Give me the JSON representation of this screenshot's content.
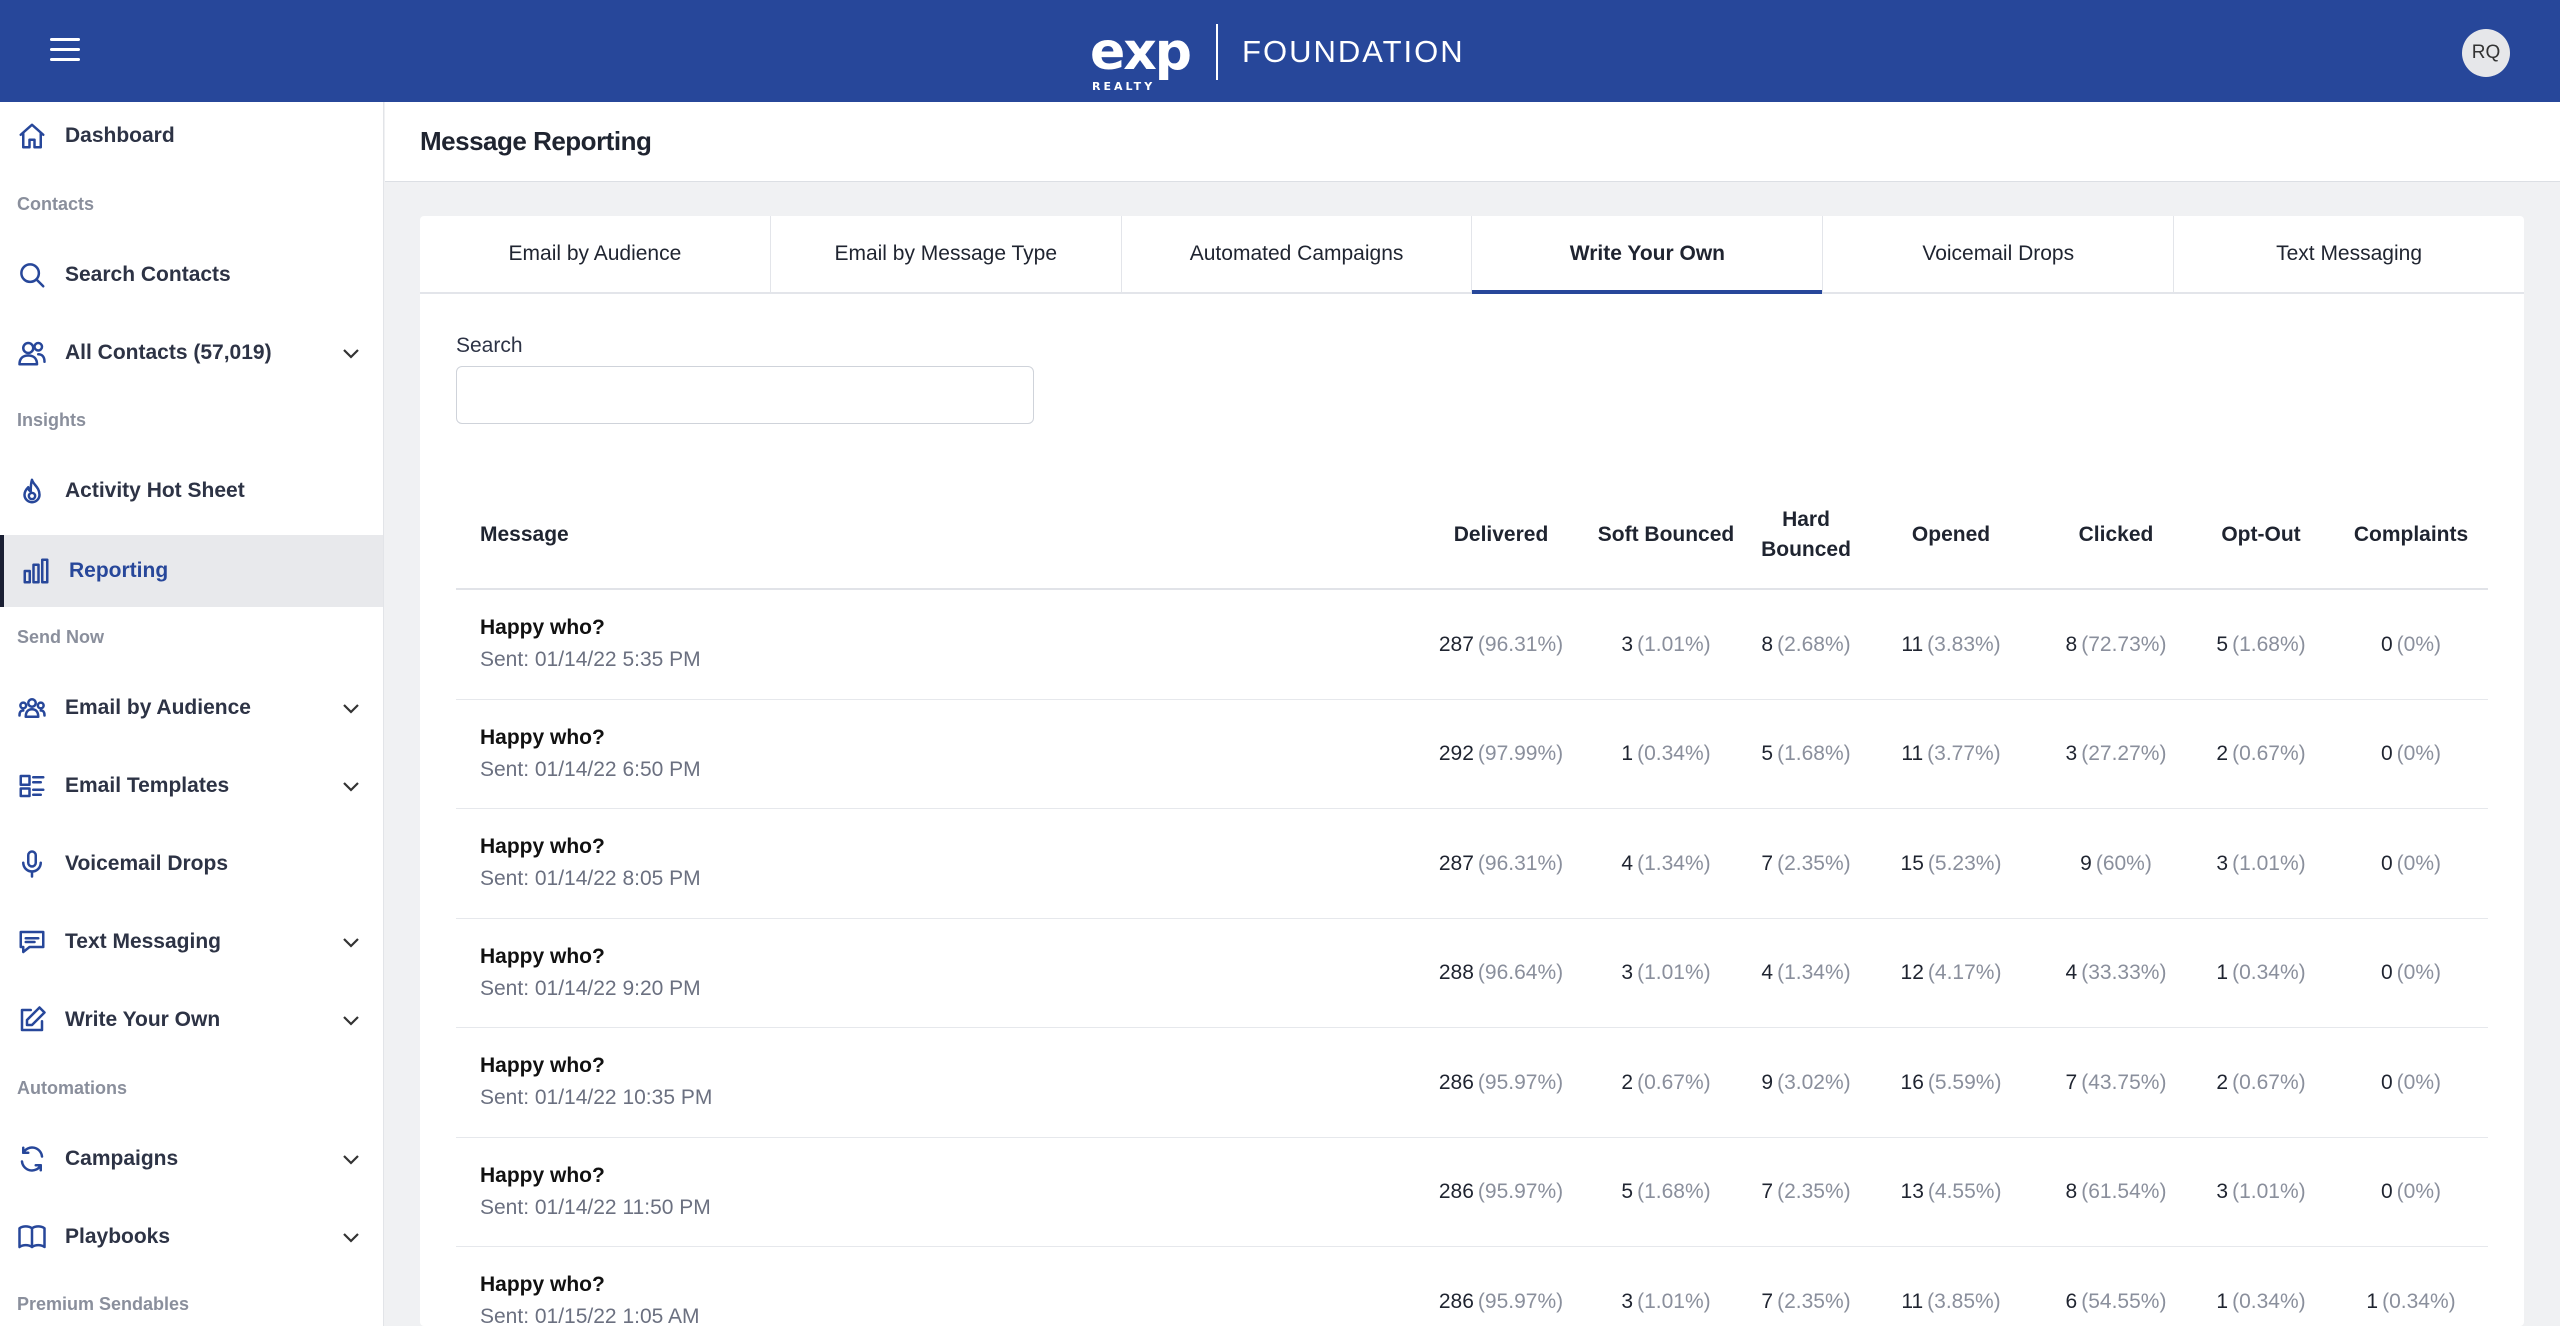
{
  "header": {
    "logo_text": "exp",
    "logo_sub": "REALTY",
    "brand": "FOUNDATION",
    "avatar_initials": "RQ",
    "bar_color": "#27479a"
  },
  "sidebar": {
    "items": [
      {
        "label": "Dashboard",
        "icon": "home-icon"
      },
      {
        "section": "Contacts"
      },
      {
        "label": "Search Contacts",
        "icon": "search-icon"
      },
      {
        "label": "All Contacts (57,019)",
        "icon": "users-icon",
        "expandable": true
      },
      {
        "section": "Insights"
      },
      {
        "label": "Activity Hot Sheet",
        "icon": "flame-icon"
      },
      {
        "label": "Reporting",
        "icon": "bar-chart-icon",
        "active": true
      },
      {
        "section": "Send Now"
      },
      {
        "label": "Email by Audience",
        "icon": "group-icon",
        "expandable": true
      },
      {
        "label": "Email Templates",
        "icon": "template-icon",
        "expandable": true
      },
      {
        "label": "Voicemail Drops",
        "icon": "microphone-icon"
      },
      {
        "label": "Text Messaging",
        "icon": "chat-icon",
        "expandable": true
      },
      {
        "label": "Write Your Own",
        "icon": "edit-icon",
        "expandable": true
      },
      {
        "section": "Automations"
      },
      {
        "label": "Campaigns",
        "icon": "refresh-icon",
        "expandable": true
      },
      {
        "label": "Playbooks",
        "icon": "book-icon",
        "expandable": true
      },
      {
        "section": "Premium Sendables"
      }
    ]
  },
  "page": {
    "title": "Message Reporting"
  },
  "tabs": [
    {
      "label": "Email by Audience"
    },
    {
      "label": "Email by Message Type"
    },
    {
      "label": "Automated Campaigns"
    },
    {
      "label": "Write Your Own",
      "active": true
    },
    {
      "label": "Voicemail Drops"
    },
    {
      "label": "Text Messaging"
    }
  ],
  "search": {
    "label": "Search",
    "value": "",
    "placeholder": ""
  },
  "table": {
    "columns": [
      "Message",
      "Delivered",
      "Soft Bounced",
      "Hard Bounced",
      "Opened",
      "Clicked",
      "Opt-Out",
      "Complaints"
    ],
    "rows": [
      {
        "title": "Happy who?",
        "sent": "Sent: 01/14/22 5:35 PM",
        "cells": [
          [
            "287",
            "(96.31%)"
          ],
          [
            "3",
            "(1.01%)"
          ],
          [
            "8",
            "(2.68%)"
          ],
          [
            "11",
            "(3.83%)"
          ],
          [
            "8",
            "(72.73%)"
          ],
          [
            "5",
            "(1.68%)"
          ],
          [
            "0",
            "(0%)"
          ]
        ]
      },
      {
        "title": "Happy who?",
        "sent": "Sent: 01/14/22 6:50 PM",
        "cells": [
          [
            "292",
            "(97.99%)"
          ],
          [
            "1",
            "(0.34%)"
          ],
          [
            "5",
            "(1.68%)"
          ],
          [
            "11",
            "(3.77%)"
          ],
          [
            "3",
            "(27.27%)"
          ],
          [
            "2",
            "(0.67%)"
          ],
          [
            "0",
            "(0%)"
          ]
        ]
      },
      {
        "title": "Happy who?",
        "sent": "Sent: 01/14/22 8:05 PM",
        "cells": [
          [
            "287",
            "(96.31%)"
          ],
          [
            "4",
            "(1.34%)"
          ],
          [
            "7",
            "(2.35%)"
          ],
          [
            "15",
            "(5.23%)"
          ],
          [
            "9",
            "(60%)"
          ],
          [
            "3",
            "(1.01%)"
          ],
          [
            "0",
            "(0%)"
          ]
        ]
      },
      {
        "title": "Happy who?",
        "sent": "Sent: 01/14/22 9:20 PM",
        "cells": [
          [
            "288",
            "(96.64%)"
          ],
          [
            "3",
            "(1.01%)"
          ],
          [
            "4",
            "(1.34%)"
          ],
          [
            "12",
            "(4.17%)"
          ],
          [
            "4",
            "(33.33%)"
          ],
          [
            "1",
            "(0.34%)"
          ],
          [
            "0",
            "(0%)"
          ]
        ]
      },
      {
        "title": "Happy who?",
        "sent": "Sent: 01/14/22 10:35 PM",
        "cells": [
          [
            "286",
            "(95.97%)"
          ],
          [
            "2",
            "(0.67%)"
          ],
          [
            "9",
            "(3.02%)"
          ],
          [
            "16",
            "(5.59%)"
          ],
          [
            "7",
            "(43.75%)"
          ],
          [
            "2",
            "(0.67%)"
          ],
          [
            "0",
            "(0%)"
          ]
        ]
      },
      {
        "title": "Happy who?",
        "sent": "Sent: 01/14/22 11:50 PM",
        "cells": [
          [
            "286",
            "(95.97%)"
          ],
          [
            "5",
            "(1.68%)"
          ],
          [
            "7",
            "(2.35%)"
          ],
          [
            "13",
            "(4.55%)"
          ],
          [
            "8",
            "(61.54%)"
          ],
          [
            "3",
            "(1.01%)"
          ],
          [
            "0",
            "(0%)"
          ]
        ]
      },
      {
        "title": "Happy who?",
        "sent": "Sent: 01/15/22 1:05 AM",
        "cells": [
          [
            "286",
            "(95.97%)"
          ],
          [
            "3",
            "(1.01%)"
          ],
          [
            "7",
            "(2.35%)"
          ],
          [
            "11",
            "(3.85%)"
          ],
          [
            "6",
            "(54.55%)"
          ],
          [
            "1",
            "(0.34%)"
          ],
          [
            "1",
            "(0.34%)"
          ]
        ]
      }
    ]
  }
}
